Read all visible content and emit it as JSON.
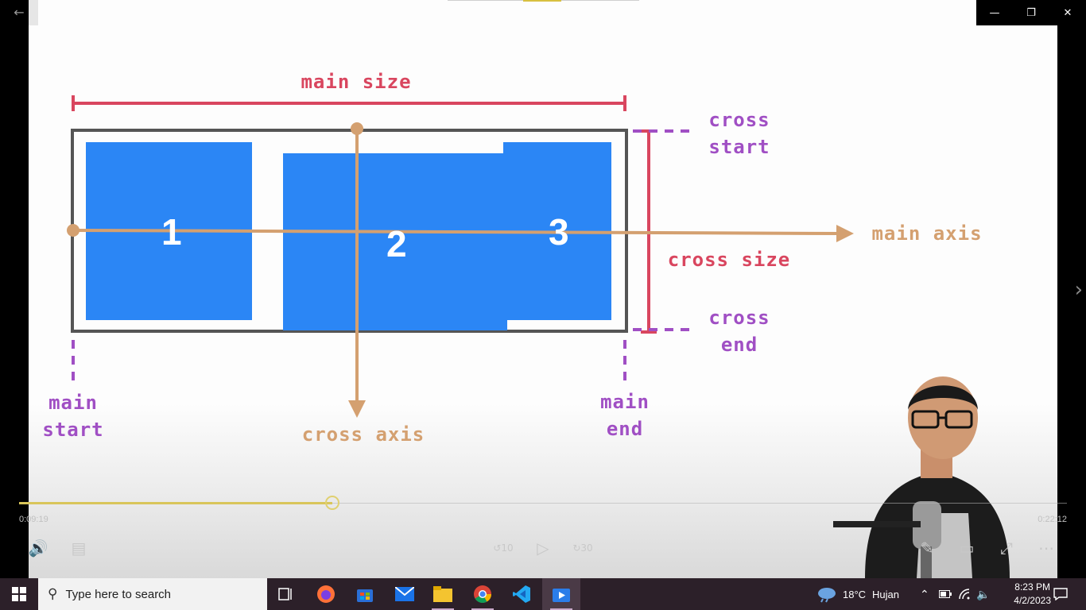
{
  "diagram": {
    "main_size": "main size",
    "cross_start": "cross\nstart",
    "cross_end": "cross\nend",
    "cross_size": "cross size",
    "main_axis": "main axis",
    "cross_axis": "cross axis",
    "main_start": "main\nstart",
    "main_end": "main\nend",
    "items": [
      "1",
      "2",
      "3"
    ],
    "colors": {
      "red": "#d9465f",
      "purple": "#a04fc4",
      "tan": "#d4a070",
      "item_blue": "#2b86f5",
      "container_border": "#555555"
    }
  },
  "player": {
    "current_time": "0:09:19",
    "total_time": "0:22:12",
    "progress_fraction": 0.299,
    "skip_back_seconds": "10",
    "skip_forward_seconds": "30",
    "icons": [
      "volume-icon",
      "captions-icon",
      "skip-back-icon",
      "play-icon",
      "skip-forward-icon",
      "edit-icon",
      "miniplayer-icon",
      "fullscreen-icon",
      "more-icon"
    ]
  },
  "window": {
    "icons": [
      "back-arrow-icon",
      "minimize-icon",
      "restore-icon",
      "close-icon",
      "next-arrow-icon"
    ]
  },
  "taskbar": {
    "search_placeholder": "Type here to search",
    "apps": [
      "task-view",
      "firefox",
      "microsoft-store",
      "mail",
      "file-explorer",
      "chrome",
      "vscode",
      "video-player"
    ],
    "weather_temp": "18°C",
    "weather_text": "Hujan",
    "time": "8:23 PM",
    "date": "4/2/2023"
  }
}
